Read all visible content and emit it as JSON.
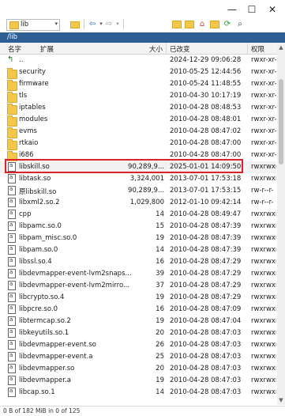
{
  "toolbar": {
    "path_value": "lib",
    "dropdown_glyph": "▾",
    "back_glyph": "⇦",
    "back_dd": "▾",
    "forward_glyph": "⇨",
    "forward_dd": "▾",
    "icons": [
      "folder-up-icon",
      "new-folder-icon",
      "home-icon",
      "bookmark-icon",
      "refresh-icon",
      "find-icon"
    ]
  },
  "window": {
    "min": "—",
    "max": "☐",
    "close": "✕"
  },
  "path_bar": {
    "text": "/lib"
  },
  "columns": {
    "name": "名字",
    "ext": "扩展",
    "size": "大小",
    "modified": "已改变",
    "perms": "权限"
  },
  "files": [
    {
      "name": "..",
      "size": "",
      "modified": "2024-12-29 09:06:28",
      "perms": "rwxr-xr-",
      "type": "up"
    },
    {
      "name": "security",
      "size": "",
      "modified": "2010-05-25 12:44:56",
      "perms": "rwxr-xr-",
      "type": "folder"
    },
    {
      "name": "firmware",
      "size": "",
      "modified": "2010-05-24 11:48:55",
      "perms": "rwxr-xr-",
      "type": "folder"
    },
    {
      "name": "tls",
      "size": "",
      "modified": "2010-04-30 10:17:19",
      "perms": "rwxr-xr-",
      "type": "folder"
    },
    {
      "name": "iptables",
      "size": "",
      "modified": "2010-04-28 08:48:53",
      "perms": "rwxr-xr-",
      "type": "folder"
    },
    {
      "name": "modules",
      "size": "",
      "modified": "2010-04-28 08:48:01",
      "perms": "rwxr-xr-",
      "type": "folder"
    },
    {
      "name": "evms",
      "size": "",
      "modified": "2010-04-28 08:47:02",
      "perms": "rwxr-xr-",
      "type": "folder"
    },
    {
      "name": "rtkaio",
      "size": "",
      "modified": "2010-04-28 08:47:00",
      "perms": "rwxr-xr-",
      "type": "folder"
    },
    {
      "name": "i686",
      "size": "",
      "modified": "2010-04-28 08:47:00",
      "perms": "rwxr-xr-",
      "type": "folder"
    },
    {
      "name": "libskill.so",
      "size": "90,289,9...",
      "modified": "2025-01-01 14:09:50",
      "perms": "rwxrwxr",
      "type": "file",
      "selected": true
    },
    {
      "name": "libtask.so",
      "size": "3,324,001",
      "modified": "2013-07-01 17:53:18",
      "perms": "rwxrwxr",
      "type": "file"
    },
    {
      "name": "原libskill.so",
      "size": "90,289,9...",
      "modified": "2013-07-01 17:53:15",
      "perms": "rw-r--r-",
      "type": "file"
    },
    {
      "name": "libxml2.so.2",
      "size": "1,029,800",
      "modified": "2012-01-10 09:42:14",
      "perms": "rw-r--r-",
      "type": "file"
    },
    {
      "name": "cpp",
      "size": "14",
      "modified": "2010-04-28 08:49:47",
      "perms": "rwxrwxr",
      "type": "file"
    },
    {
      "name": "libpamc.so.0",
      "size": "15",
      "modified": "2010-04-28 08:47:39",
      "perms": "rwxrwxr",
      "type": "file"
    },
    {
      "name": "libpam_misc.so.0",
      "size": "19",
      "modified": "2010-04-28 08:47:39",
      "perms": "rwxrwxr",
      "type": "file"
    },
    {
      "name": "libpam.so.0",
      "size": "14",
      "modified": "2010-04-28 08:47:39",
      "perms": "rwxrwxr",
      "type": "file"
    },
    {
      "name": "libssl.so.4",
      "size": "16",
      "modified": "2010-04-28 08:47:29",
      "perms": "rwxrwxr",
      "type": "file"
    },
    {
      "name": "libdevmapper-event-lvm2snaps...",
      "size": "39",
      "modified": "2010-04-28 08:47:29",
      "perms": "rwxrwxr",
      "type": "file"
    },
    {
      "name": "libdevmapper-event-lvm2mirro...",
      "size": "37",
      "modified": "2010-04-28 08:47:29",
      "perms": "rwxrwxr",
      "type": "file"
    },
    {
      "name": "libcrypto.so.4",
      "size": "19",
      "modified": "2010-04-28 08:47:29",
      "perms": "rwxrwxr",
      "type": "file"
    },
    {
      "name": "libpcre.so.0",
      "size": "16",
      "modified": "2010-04-28 08:47:09",
      "perms": "rwxrwxr",
      "type": "file"
    },
    {
      "name": "libtermcap.so.2",
      "size": "19",
      "modified": "2010-04-28 08:47:04",
      "perms": "rwxrwxr",
      "type": "file"
    },
    {
      "name": "libkeyutils.so.1",
      "size": "20",
      "modified": "2010-04-28 08:47:03",
      "perms": "rwxrwxr",
      "type": "file"
    },
    {
      "name": "libdevmapper-event.so",
      "size": "26",
      "modified": "2010-04-28 08:47:03",
      "perms": "rwxrwxr",
      "type": "file"
    },
    {
      "name": "libdevmapper-event.a",
      "size": "25",
      "modified": "2010-04-28 08:47:03",
      "perms": "rwxrwxr",
      "type": "file"
    },
    {
      "name": "libdevmapper.so",
      "size": "20",
      "modified": "2010-04-28 08:47:03",
      "perms": "rwxrwxr",
      "type": "file"
    },
    {
      "name": "libdevmapper.a",
      "size": "19",
      "modified": "2010-04-28 08:47:03",
      "perms": "rwxrwxr",
      "type": "file"
    },
    {
      "name": "libcap.so.1",
      "size": "14",
      "modified": "2010-04-28 08:47:03",
      "perms": "rwxrwxr",
      "type": "file"
    }
  ],
  "status": {
    "text": "0 B of 182 MiB in 0 of 125"
  },
  "colors": {
    "path_bar": "#2f5e95",
    "highlight": "#e0202a",
    "folder": "#f3c84a"
  }
}
